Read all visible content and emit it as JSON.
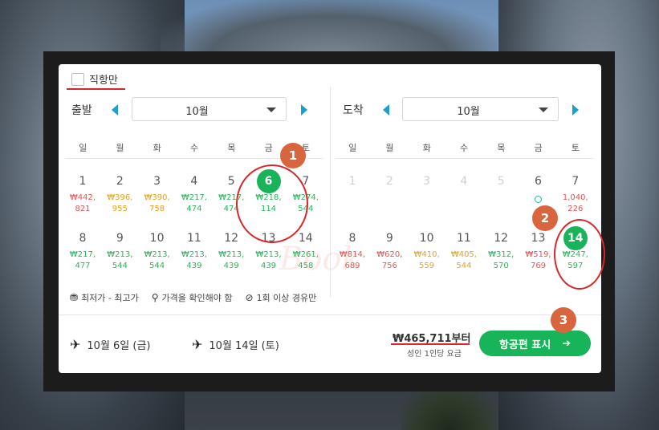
{
  "filter": {
    "direct_only_label": "직항만"
  },
  "depart": {
    "label": "출발",
    "month": "10월",
    "weekdays": [
      "일",
      "월",
      "화",
      "수",
      "목",
      "금",
      "토"
    ],
    "week1": [
      {
        "day": "1",
        "price": "₩442,\n821",
        "tone": "r"
      },
      {
        "day": "2",
        "price": "₩396,\n955",
        "tone": "o"
      },
      {
        "day": "3",
        "price": "₩390,\n758",
        "tone": "o"
      },
      {
        "day": "4",
        "price": "₩217,\n474",
        "tone": "g"
      },
      {
        "day": "5",
        "price": "₩217,\n474",
        "tone": "g"
      },
      {
        "day": "6",
        "price": "₩218,\n114",
        "tone": "g",
        "selected": true
      },
      {
        "day": "7",
        "price": "₩274,\n544",
        "tone": "g"
      }
    ],
    "week2": [
      {
        "day": "8",
        "price": "₩217,\n477",
        "tone": "g"
      },
      {
        "day": "9",
        "price": "₩213,\n544",
        "tone": "g"
      },
      {
        "day": "10",
        "price": "₩213,\n544",
        "tone": "g"
      },
      {
        "day": "11",
        "price": "₩213,\n439",
        "tone": "g"
      },
      {
        "day": "12",
        "price": "₩213,\n439",
        "tone": "g"
      },
      {
        "day": "13",
        "price": "₩213,\n439",
        "tone": "g"
      },
      {
        "day": "14",
        "price": "₩261,\n458",
        "tone": "g"
      }
    ]
  },
  "arrive": {
    "label": "도착",
    "month": "10월",
    "weekdays": [
      "일",
      "월",
      "화",
      "수",
      "목",
      "금",
      "토"
    ],
    "week1": [
      {
        "day": "1",
        "faded": true
      },
      {
        "day": "2",
        "faded": true
      },
      {
        "day": "3",
        "faded": true
      },
      {
        "day": "4",
        "faded": true
      },
      {
        "day": "5",
        "faded": true
      },
      {
        "day": "6",
        "dot": true
      },
      {
        "day": "7",
        "price": "1,040,\n226",
        "tone": "r"
      }
    ],
    "week2": [
      {
        "day": "8",
        "price": "₩814,\n689",
        "tone": "r"
      },
      {
        "day": "9",
        "price": "₩620,\n756",
        "tone": "r"
      },
      {
        "day": "10",
        "price": "₩410,\n559",
        "tone": "o"
      },
      {
        "day": "11",
        "price": "₩405,\n544",
        "tone": "o"
      },
      {
        "day": "12",
        "price": "₩312,\n570",
        "tone": "g"
      },
      {
        "day": "13",
        "price": "₩519,\n769",
        "tone": "r"
      },
      {
        "day": "14",
        "price": "₩247,\n597",
        "tone": "g",
        "selected": true
      }
    ]
  },
  "legend": {
    "range": "최저가 - 최고가",
    "check_price": "가격을 확인해야 함",
    "stopover": "1회 이상 경유만"
  },
  "footer": {
    "depart_date": "10월 6일 (금)",
    "return_date": "10월 14일 (토)",
    "price": "₩465,711부터",
    "price_note": "성인 1인당 요금",
    "show_flights": "항공편 표시",
    "arrow": "➔"
  },
  "annotations": [
    "1",
    "2",
    "3"
  ],
  "watermark": "Book"
}
